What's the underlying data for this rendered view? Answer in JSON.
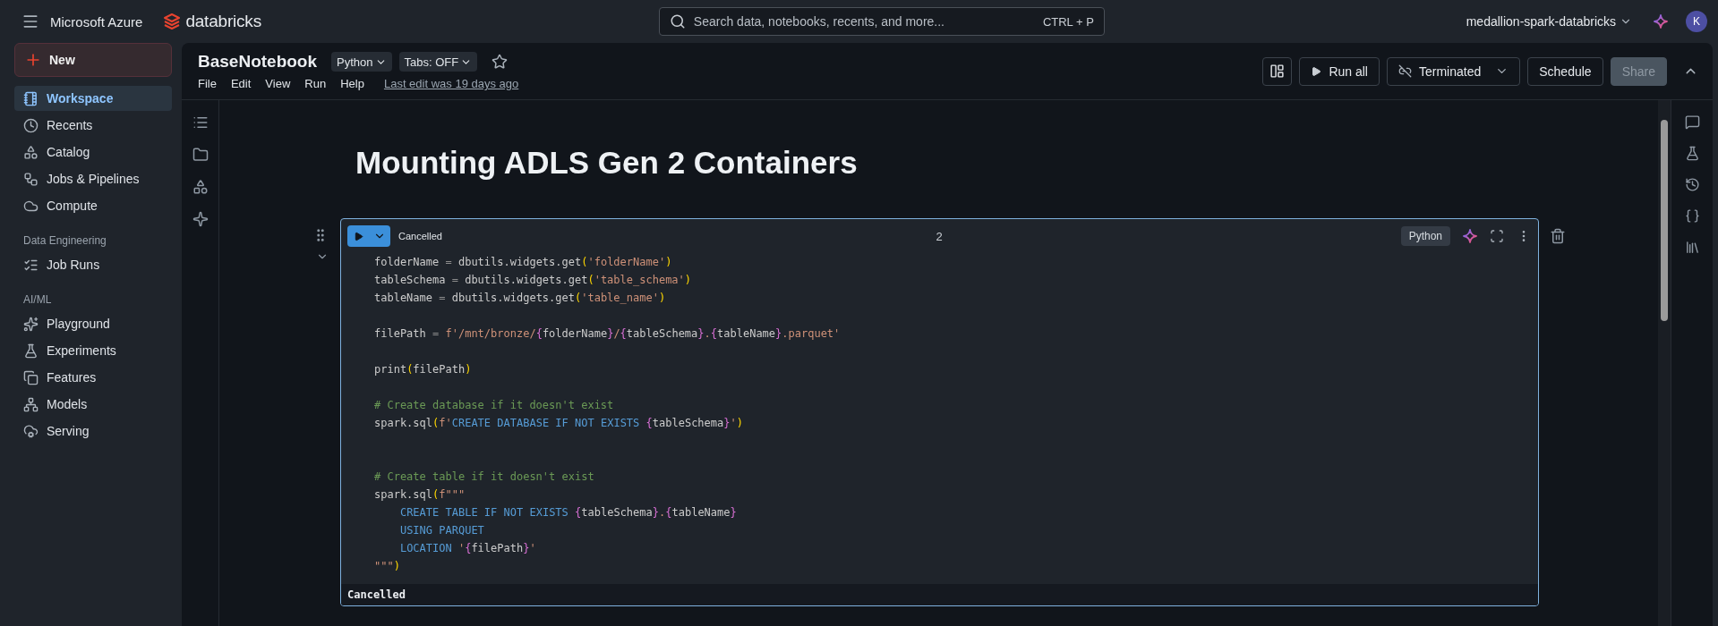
{
  "top_bar": {
    "product": "Microsoft Azure",
    "brand": "databricks",
    "search": {
      "placeholder": "Search data, notebooks, recents, and more...",
      "shortcut": "CTRL + P"
    },
    "workspace": "medallion-spark-databricks",
    "avatar": "K"
  },
  "sidebar": {
    "new_button": "New",
    "sections": [
      {
        "items": [
          {
            "label": "Workspace",
            "selected": true
          },
          {
            "label": "Recents",
            "selected": false
          },
          {
            "label": "Catalog",
            "selected": false
          },
          {
            "label": "Jobs & Pipelines",
            "selected": false
          },
          {
            "label": "Compute",
            "selected": false
          }
        ]
      },
      {
        "heading": "Data Engineering",
        "items": [
          {
            "label": "Job Runs",
            "selected": false
          }
        ]
      },
      {
        "heading": "AI/ML",
        "items": [
          {
            "label": "Playground",
            "selected": false
          },
          {
            "label": "Experiments",
            "selected": false
          },
          {
            "label": "Features",
            "selected": false
          },
          {
            "label": "Models",
            "selected": false
          },
          {
            "label": "Serving",
            "selected": false
          }
        ]
      }
    ]
  },
  "notebook": {
    "title": "BaseNotebook",
    "language": "Python",
    "tabs_setting": "Tabs: OFF",
    "starred": false,
    "menus": [
      "File",
      "Edit",
      "View",
      "Run",
      "Help"
    ],
    "last_edit": "Last edit was 19 days ago",
    "actions": {
      "run_all": "Run all",
      "compute": "Terminated",
      "schedule": "Schedule",
      "share": {
        "label": "Share",
        "disabled": true
      }
    }
  },
  "heading": "Mounting ADLS Gen 2 Containers",
  "cell": {
    "status": "Cancelled",
    "number": "2",
    "language": "Python",
    "code": "folderName = dbutils.widgets.get('folderName')\ntableSchema = dbutils.widgets.get('table_schema')\ntableName = dbutils.widgets.get('table_name')\n\nfilePath = f'/mnt/bronze/{folderName}/{tableSchema}.{tableName}.parquet'\n\nprint(filePath)\n\n# Create database if it doesn't exist\nspark.sql(f'CREATE DATABASE IF NOT EXISTS {tableSchema}')\n\n\n# Create table if it doesn't exist\nspark.sql(f\"\"\"\n    CREATE TABLE IF NOT EXISTS {tableSchema}.{tableName}\n    USING PARQUET\n    LOCATION '{filePath}'\n\"\"\")",
    "output": "Cancelled"
  }
}
